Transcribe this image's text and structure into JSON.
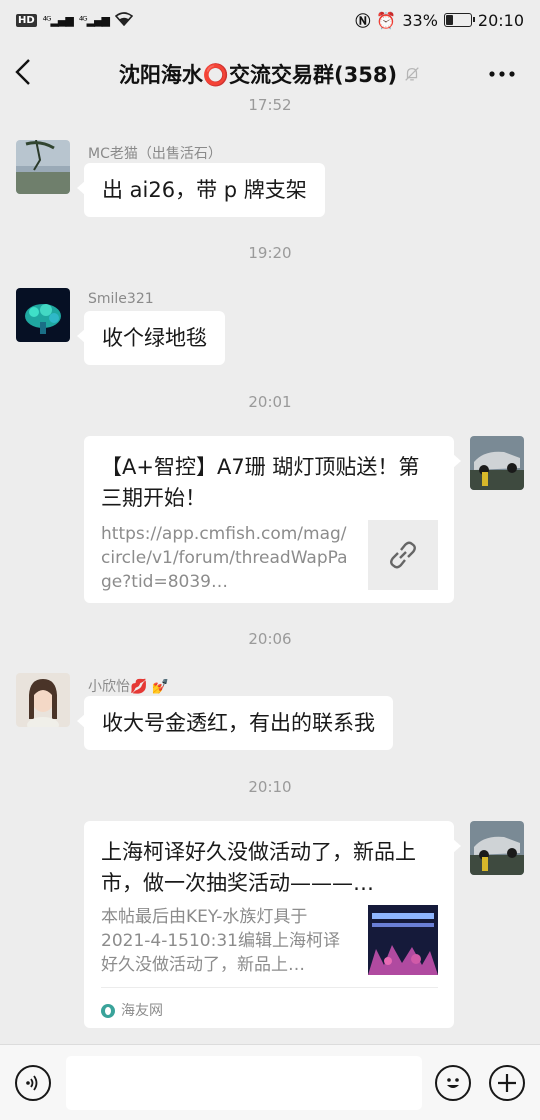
{
  "status_bar": {
    "left_icons": [
      "HD",
      "4G",
      "4G",
      "wifi"
    ],
    "battery_percent": "33%",
    "battery_level": 0.33,
    "time": "20:10"
  },
  "nav": {
    "title": "沈阳海水⭕交流交易群(358)",
    "back_icon": "chevron-left-icon",
    "mute_icon": "bell-off-icon",
    "more_icon": "more-icon"
  },
  "messages": {
    "time_partial": "17:52",
    "msg1": {
      "sender": "MC老猫（出售活石）",
      "text": "出 ai26，带 p 牌支架"
    },
    "time1": "19:20",
    "msg2": {
      "sender": "Smile321",
      "text": "收个绿地毯"
    },
    "time2": "20:01",
    "msg3": {
      "title": "【A+智控】A7珊 瑚灯顶贴送！第三期开始！",
      "desc": "https://app.cmfish.com/mag/circle/v1/forum/threadWapPage?tid=8039…"
    },
    "time3": "20:06",
    "msg4": {
      "sender": "小欣怡💋 💅",
      "text": "收大号金透红，有出的联系我"
    },
    "time4": "20:10",
    "msg5": {
      "title": "上海柯译好久没做活动了，新品上市，做一次抽奖活动———…",
      "desc": "本帖最后由KEY-水族灯具于2021-4-1510:31编辑上海柯译好久没做活动了，新品上…",
      "source": "海友网"
    }
  },
  "input_bar": {
    "voice_icon": "voice-icon",
    "emoji_icon": "emoji-icon",
    "plus_icon": "plus-icon"
  },
  "colors": {
    "background": "#ededed",
    "bubble": "#ffffff",
    "timestamp": "#9a9a9a"
  }
}
